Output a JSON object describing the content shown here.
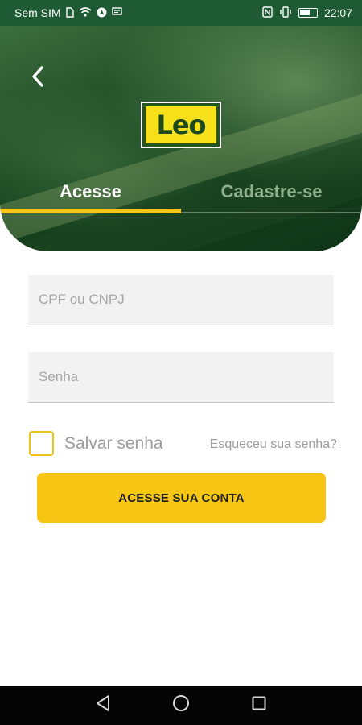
{
  "status_bar": {
    "carrier": "Sem SIM",
    "time": "22:07",
    "icons": [
      "sim-icon",
      "wifi-icon",
      "alert-icon",
      "message-icon",
      "nfc-icon",
      "vibrate-icon",
      "battery-icon"
    ]
  },
  "header": {
    "back_icon": "chevron-left-icon",
    "logo_text": "Leo",
    "tabs": [
      {
        "label": "Acesse",
        "active": true
      },
      {
        "label": "Cadastre-se",
        "active": false
      }
    ]
  },
  "form": {
    "document_placeholder": "CPF ou CNPJ",
    "password_placeholder": "Senha",
    "remember_label": "Salvar senha",
    "remember_checked": false,
    "forgot_link": "Esqueceu sua senha?",
    "submit_label": "ACESSE SUA CONTA"
  },
  "nav": {
    "back_icon": "triangle-back-icon",
    "home_icon": "circle-home-icon",
    "recents_icon": "square-recents-icon"
  },
  "colors": {
    "brand_green": "#1e5a34",
    "accent_yellow": "#f7c614"
  }
}
